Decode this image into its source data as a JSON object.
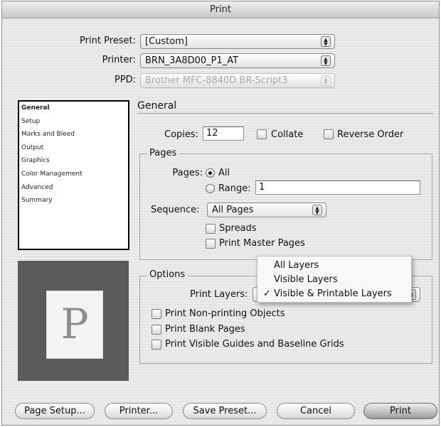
{
  "window": {
    "title": "Print"
  },
  "header": {
    "print_preset_label": "Print Preset:",
    "print_preset_value": "[Custom]",
    "printer_label": "Printer:",
    "printer_value": "BRN_3A8D00_P1_AT",
    "ppd_label": "PPD:",
    "ppd_value": "Brother MFC-8840D BR-Script3"
  },
  "sidebar": {
    "items": [
      {
        "label": "General",
        "selected": true
      },
      {
        "label": "Setup"
      },
      {
        "label": "Marks and Bleed"
      },
      {
        "label": "Output"
      },
      {
        "label": "Graphics"
      },
      {
        "label": "Color Management"
      },
      {
        "label": "Advanced"
      },
      {
        "label": "Summary"
      }
    ]
  },
  "preview": {
    "glyph": "P"
  },
  "general": {
    "title": "General",
    "copies_label": "Copies:",
    "copies_value": "12",
    "collate_label": "Collate",
    "reverse_order_label": "Reverse Order"
  },
  "pages": {
    "group_label": "Pages",
    "pages_label": "Pages:",
    "all_label": "All",
    "range_label": "Range:",
    "range_value": "1",
    "sequence_label": "Sequence:",
    "sequence_value": "All Pages",
    "spreads_label": "Spreads",
    "print_master_pages_label": "Print Master Pages"
  },
  "options": {
    "group_label": "Options",
    "print_layers_label": "Print Layers:",
    "layers_menu": [
      {
        "label": "All Layers",
        "checked": false
      },
      {
        "label": "Visible Layers",
        "checked": false
      },
      {
        "label": "Visible & Printable Layers",
        "checked": true
      }
    ],
    "check_mark": "✓",
    "print_nonprinting_label": "Print Non-printing Objects",
    "print_blank_pages_label": "Print Blank Pages",
    "print_guides_label": "Print Visible Guides and Baseline Grids"
  },
  "buttons": {
    "page_setup": "Page Setup...",
    "printer": "Printer...",
    "save_preset": "Save Preset...",
    "cancel": "Cancel",
    "print": "Print"
  },
  "icons": {
    "stepper": "up-down-arrows-icon"
  }
}
